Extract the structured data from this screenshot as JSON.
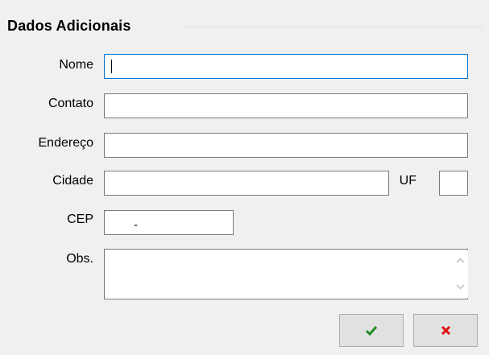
{
  "group": {
    "title": "Dados Adicionais"
  },
  "fields": {
    "nome": {
      "label": "Nome",
      "value": ""
    },
    "contato": {
      "label": "Contato",
      "value": ""
    },
    "endereco": {
      "label": "Endereço",
      "value": ""
    },
    "cidade": {
      "label": "Cidade",
      "value": ""
    },
    "uf": {
      "label": "UF",
      "value": ""
    },
    "cep": {
      "label": "CEP",
      "mask": "-"
    },
    "obs": {
      "label": "Obs.",
      "value": ""
    }
  },
  "buttons": {
    "confirm": {
      "icon": "check-icon",
      "color": "#1e8c1e"
    },
    "cancel": {
      "icon": "close-icon",
      "color": "#e01010"
    }
  }
}
